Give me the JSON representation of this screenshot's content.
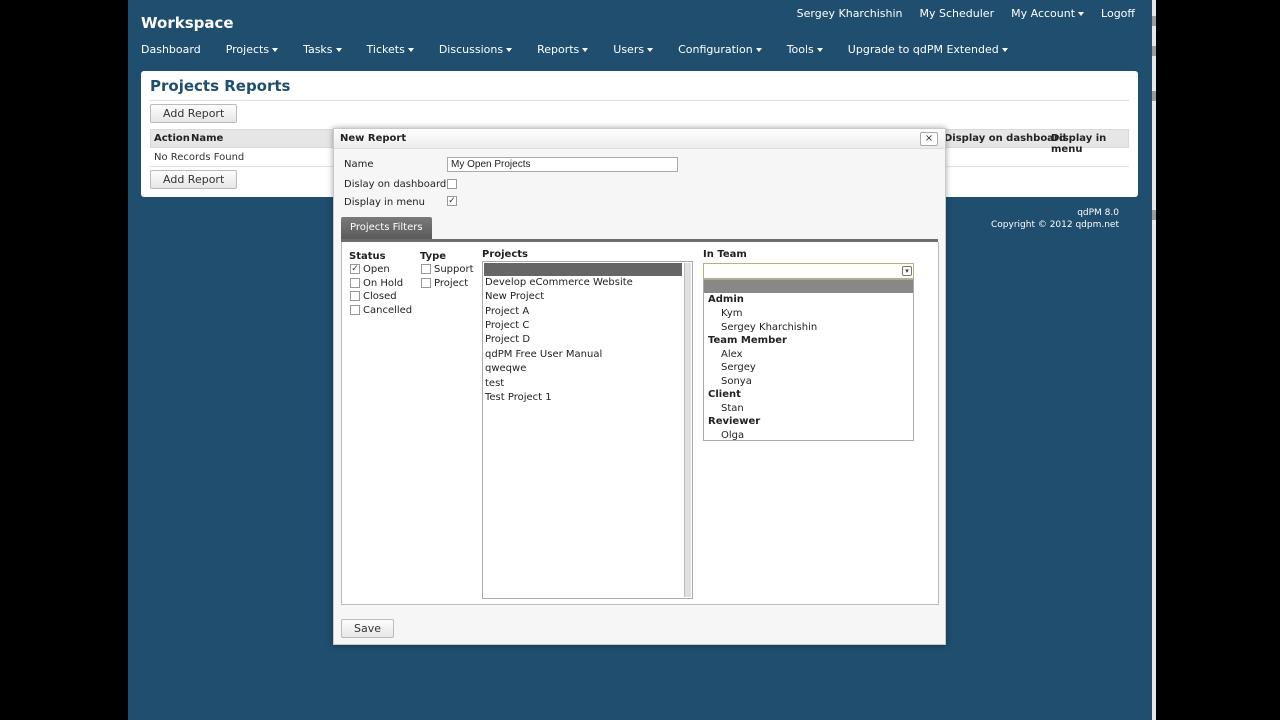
{
  "app": {
    "brand": "Workspace",
    "top_links": [
      "Sergey Kharchishin",
      "My Scheduler",
      "My Account",
      "Logoff"
    ],
    "nav": [
      "Dashboard",
      "Projects",
      "Tasks",
      "Tickets",
      "Discussions",
      "Reports",
      "Users",
      "Configuration",
      "Tools",
      "Upgrade to qdPM Extended"
    ]
  },
  "page": {
    "title": "Projects Reports",
    "add_report_label": "Add Report",
    "columns": [
      "Action",
      "Name",
      "Display on dashboard",
      "Display in menu"
    ],
    "empty_message": "No Records Found"
  },
  "footer": {
    "version": "qdPM 8.0",
    "copyright": "Copyright © 2012 qdpm.net"
  },
  "modal": {
    "title": "New Report",
    "close_label": "×",
    "name_label": "Name",
    "name_value": "My Open Projects",
    "dashboard_label": "Dislay on dashboard",
    "dashboard_checked": false,
    "menu_label": "Display in menu",
    "menu_checked": true,
    "tab_label": "Projects Filters",
    "save_label": "Save",
    "filters": {
      "status_heading": "Status",
      "status_options": [
        {
          "label": "Open",
          "checked": true
        },
        {
          "label": "On Hold",
          "checked": false
        },
        {
          "label": "Closed",
          "checked": false
        },
        {
          "label": "Cancelled",
          "checked": false
        }
      ],
      "type_heading": "Type",
      "type_options": [
        {
          "label": "Support",
          "checked": false
        },
        {
          "label": "Project",
          "checked": false
        }
      ],
      "projects_heading": "Projects",
      "projects": [
        "Develop eCommerce Website",
        "New Project",
        "Project A",
        "Project C",
        "Project D",
        "qdPM Free User Manual",
        "qweqwe",
        "test",
        "Test Project 1"
      ],
      "team_heading": "In Team",
      "team_groups": [
        {
          "group": "Admin",
          "members": [
            "Kym",
            "Sergey Kharchishin"
          ]
        },
        {
          "group": "Team Member",
          "members": [
            "Alex",
            "Sergey",
            "Sonya"
          ]
        },
        {
          "group": "Client",
          "members": [
            "Stan"
          ]
        },
        {
          "group": "Reviewer",
          "members": [
            "Olga"
          ]
        }
      ]
    }
  },
  "colors": {
    "background": "#1f4e6e",
    "title_text": "#1f4e6e",
    "tab": "#5b5b5b"
  }
}
